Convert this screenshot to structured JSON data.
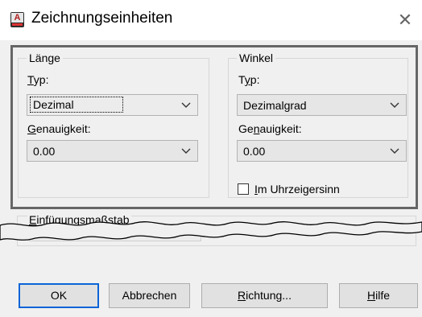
{
  "window": {
    "title": "Zeichnungseinheiten",
    "close_glyph": "✕"
  },
  "length": {
    "legend": "Länge",
    "type_label_mnemonic": "T",
    "type_label_rest": "yp:",
    "type_value": "Dezimal",
    "precision_label_mnemonic": "G",
    "precision_label_rest": "enauigkeit:",
    "precision_value": "0.00"
  },
  "angle": {
    "legend": "Winkel",
    "type_label_pre": "T",
    "type_label_mnemonic": "y",
    "type_label_rest": "p:",
    "type_value": "Dezimalgrad",
    "precision_label_pre": "Ge",
    "precision_label_mnemonic": "n",
    "precision_label_rest": "auigkeit:",
    "precision_value": "0.00",
    "clockwise_mnemonic": "I",
    "clockwise_rest": "m Uhrzeigersinn",
    "clockwise_checked": false
  },
  "insertion_scale": {
    "legend_mnemonic": "E",
    "legend_rest": "infügungsmaßstab"
  },
  "buttons": {
    "ok": "OK",
    "cancel": "Abbrechen",
    "direction_mnemonic": "R",
    "direction_rest": "ichtung...",
    "help_mnemonic": "H",
    "help_rest": "ilfe"
  },
  "icons": [
    "app-icon",
    "close-icon",
    "chevron-down-icon",
    "checkbox-icon"
  ],
  "colors": {
    "focus_border": "#0a64d7",
    "highlight_border": "#666666"
  }
}
